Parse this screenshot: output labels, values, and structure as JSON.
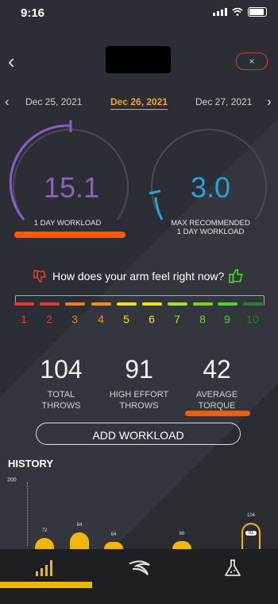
{
  "status_bar": {
    "time": "9:16"
  },
  "header": {
    "close_label": "×"
  },
  "dates": {
    "prev": "Dec 25, 2021",
    "current": "Dec 26, 2021",
    "next": "Dec 27, 2021"
  },
  "workload": {
    "value": "15.1",
    "label": "1 DAY WORKLOAD"
  },
  "max_recommended": {
    "value": "3.0",
    "label_line1": "MAX RECOMMENDED",
    "label_line2": "1 DAY WORKLOAD"
  },
  "feel": {
    "question": "How does your arm feel right now?",
    "scale": [
      {
        "n": "1",
        "color": "#e53935"
      },
      {
        "n": "2",
        "color": "#e53935"
      },
      {
        "n": "3",
        "color": "#ef7d1a"
      },
      {
        "n": "4",
        "color": "#ef8f26"
      },
      {
        "n": "5",
        "color": "#f4e11c"
      },
      {
        "n": "6",
        "color": "#f4e11c"
      },
      {
        "n": "7",
        "color": "#a6e22e"
      },
      {
        "n": "8",
        "color": "#7ed321"
      },
      {
        "n": "9",
        "color": "#4cd137"
      },
      {
        "n": "10",
        "color": "#2e7d32"
      }
    ]
  },
  "stats": [
    {
      "value": "104",
      "label_line1": "TOTAL",
      "label_line2": "THROWS"
    },
    {
      "value": "91",
      "label_line1": "HIGH EFFORT",
      "label_line2": "THROWS"
    },
    {
      "value": "42",
      "label_line1": "AVERAGE",
      "label_line2": "TORQUE"
    }
  ],
  "add_workload_label": "ADD WORKLOAD",
  "history": {
    "title": "HISTORY",
    "axis_max": "200",
    "bars": [
      {
        "label": "72",
        "value": 72
      },
      {
        "label": "84",
        "value": 84
      },
      {
        "label": "64",
        "value": 64
      },
      {
        "label": "66",
        "value": 66
      },
      {
        "label": "104",
        "value": 104,
        "inner": "91",
        "highlight": true
      }
    ]
  },
  "nav": [
    {
      "icon": "bar-chart-icon",
      "active": true
    },
    {
      "icon": "swoosh-icon",
      "active": false
    },
    {
      "icon": "flask-icon",
      "active": false
    }
  ],
  "colors": {
    "accent_orange": "#f0a33a",
    "workload_purple": "#8a5cc7",
    "max_blue": "#2d9fd9",
    "nav_yellow": "#f2b705",
    "highlight_orange": "#ff5a00"
  }
}
